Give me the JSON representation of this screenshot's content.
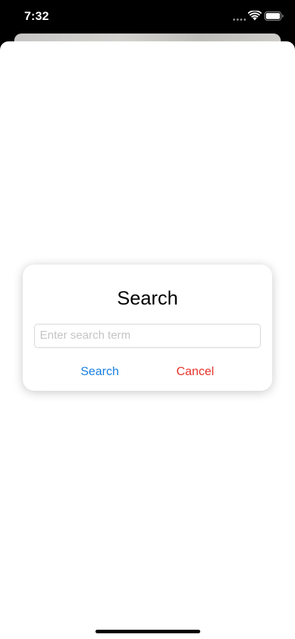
{
  "status_bar": {
    "time": "7:32",
    "icons": [
      "cellular-signal-icon",
      "wifi-icon",
      "battery-icon"
    ]
  },
  "dialog": {
    "title": "Search",
    "input": {
      "value": "",
      "placeholder": "Enter search term"
    },
    "buttons": {
      "search_label": "Search",
      "cancel_label": "Cancel"
    }
  },
  "colors": {
    "accent": "#1a7fe0",
    "destructive": "#e8322a",
    "background": "#ffffff",
    "status_bar_background": "#000000"
  }
}
